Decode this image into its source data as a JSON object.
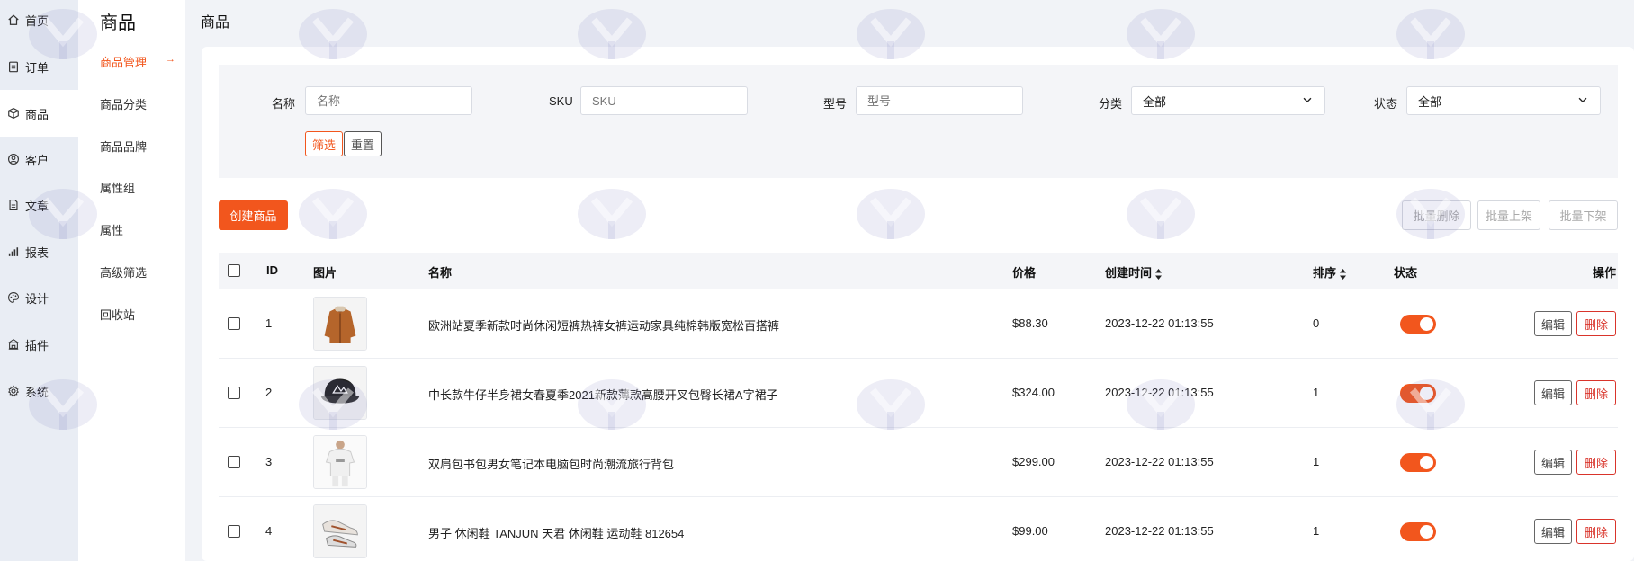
{
  "nav_primary": [
    {
      "label": "首页",
      "icon": "home-icon"
    },
    {
      "label": "订单",
      "icon": "order-icon"
    },
    {
      "label": "商品",
      "icon": "cube-icon"
    },
    {
      "label": "客户",
      "icon": "user-icon"
    },
    {
      "label": "文章",
      "icon": "document-icon"
    },
    {
      "label": "报表",
      "icon": "chart-icon"
    },
    {
      "label": "设计",
      "icon": "palette-icon"
    },
    {
      "label": "插件",
      "icon": "plugin-icon"
    },
    {
      "label": "系统",
      "icon": "gear-icon"
    }
  ],
  "nav_secondary": {
    "title": "商品",
    "items": [
      "商品管理",
      "商品分类",
      "商品品牌",
      "属性组",
      "属性",
      "高级筛选",
      "回收站"
    ],
    "active_arrow": "→"
  },
  "page_title": "商品",
  "filter": {
    "name_label": "名称",
    "name_placeholder": "名称",
    "sku_label": "SKU",
    "sku_placeholder": "SKU",
    "model_label": "型号",
    "model_placeholder": "型号",
    "category_label": "分类",
    "category_value": "全部",
    "status_label": "状态",
    "status_value": "全部",
    "filter_button": "筛选",
    "reset_button": "重置"
  },
  "actions": {
    "create": "创建商品",
    "batch_delete": "批量删除",
    "batch_on": "批量上架",
    "batch_off": "批量下架"
  },
  "table": {
    "headers": {
      "id": "ID",
      "image": "图片",
      "name": "名称",
      "price": "价格",
      "created": "创建时间",
      "sort": "排序",
      "status": "状态",
      "ops": "操作"
    },
    "edit_label": "编辑",
    "delete_label": "删除",
    "rows": [
      {
        "id": "1",
        "image": "brown-jacket",
        "name": "欧洲站夏季新款时尚休闲短裤热裤女裤运动家具纯棉韩版宽松百搭裤",
        "price": "$88.30",
        "created": "2023-12-22 01:13:55",
        "sort": "0",
        "status_on": true
      },
      {
        "id": "2",
        "image": "black-cap",
        "name": "中长款牛仔半身裙女春夏季2021新款薄款高腰开叉包臀长裙A字裙子",
        "price": "$324.00",
        "created": "2023-12-22 01:13:55",
        "sort": "1",
        "status_on": true
      },
      {
        "id": "3",
        "image": "white-tshirt",
        "name": "双肩包书包男女笔记本电脑包时尚潮流旅行背包",
        "price": "$299.00",
        "created": "2023-12-22 01:13:55",
        "sort": "1",
        "status_on": true
      },
      {
        "id": "4",
        "image": "sneakers",
        "name": "男子 休闲鞋 TANJUN 天君 休闲鞋 运动鞋 812654",
        "price": "$99.00",
        "created": "2023-12-22 01:13:55",
        "sort": "1",
        "status_on": true
      }
    ]
  },
  "colors": {
    "accent": "#f2561d",
    "danger": "#d9342b",
    "sidebar_bg": "#e9edf4"
  }
}
